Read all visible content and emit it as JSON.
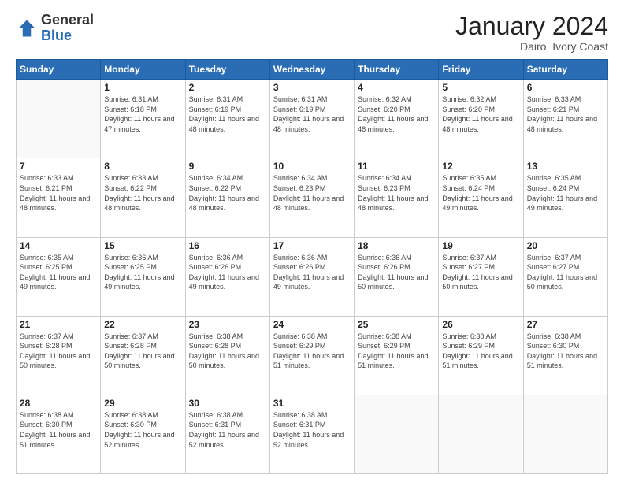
{
  "header": {
    "logo": {
      "general": "General",
      "blue": "Blue"
    },
    "title": "January 2024",
    "location": "Dairo, Ivory Coast"
  },
  "weekdays": [
    "Sunday",
    "Monday",
    "Tuesday",
    "Wednesday",
    "Thursday",
    "Friday",
    "Saturday"
  ],
  "weeks": [
    [
      {
        "day": "",
        "empty": true
      },
      {
        "day": "1",
        "sunrise": "6:31 AM",
        "sunset": "6:18 PM",
        "daylight": "11 hours and 47 minutes."
      },
      {
        "day": "2",
        "sunrise": "6:31 AM",
        "sunset": "6:19 PM",
        "daylight": "11 hours and 48 minutes."
      },
      {
        "day": "3",
        "sunrise": "6:31 AM",
        "sunset": "6:19 PM",
        "daylight": "11 hours and 48 minutes."
      },
      {
        "day": "4",
        "sunrise": "6:32 AM",
        "sunset": "6:20 PM",
        "daylight": "11 hours and 48 minutes."
      },
      {
        "day": "5",
        "sunrise": "6:32 AM",
        "sunset": "6:20 PM",
        "daylight": "11 hours and 48 minutes."
      },
      {
        "day": "6",
        "sunrise": "6:33 AM",
        "sunset": "6:21 PM",
        "daylight": "11 hours and 48 minutes."
      }
    ],
    [
      {
        "day": "7",
        "sunrise": "6:33 AM",
        "sunset": "6:21 PM",
        "daylight": "11 hours and 48 minutes."
      },
      {
        "day": "8",
        "sunrise": "6:33 AM",
        "sunset": "6:22 PM",
        "daylight": "11 hours and 48 minutes."
      },
      {
        "day": "9",
        "sunrise": "6:34 AM",
        "sunset": "6:22 PM",
        "daylight": "11 hours and 48 minutes."
      },
      {
        "day": "10",
        "sunrise": "6:34 AM",
        "sunset": "6:23 PM",
        "daylight": "11 hours and 48 minutes."
      },
      {
        "day": "11",
        "sunrise": "6:34 AM",
        "sunset": "6:23 PM",
        "daylight": "11 hours and 48 minutes."
      },
      {
        "day": "12",
        "sunrise": "6:35 AM",
        "sunset": "6:24 PM",
        "daylight": "11 hours and 49 minutes."
      },
      {
        "day": "13",
        "sunrise": "6:35 AM",
        "sunset": "6:24 PM",
        "daylight": "11 hours and 49 minutes."
      }
    ],
    [
      {
        "day": "14",
        "sunrise": "6:35 AM",
        "sunset": "6:25 PM",
        "daylight": "11 hours and 49 minutes."
      },
      {
        "day": "15",
        "sunrise": "6:36 AM",
        "sunset": "6:25 PM",
        "daylight": "11 hours and 49 minutes."
      },
      {
        "day": "16",
        "sunrise": "6:36 AM",
        "sunset": "6:26 PM",
        "daylight": "11 hours and 49 minutes."
      },
      {
        "day": "17",
        "sunrise": "6:36 AM",
        "sunset": "6:26 PM",
        "daylight": "11 hours and 49 minutes."
      },
      {
        "day": "18",
        "sunrise": "6:36 AM",
        "sunset": "6:26 PM",
        "daylight": "11 hours and 50 minutes."
      },
      {
        "day": "19",
        "sunrise": "6:37 AM",
        "sunset": "6:27 PM",
        "daylight": "11 hours and 50 minutes."
      },
      {
        "day": "20",
        "sunrise": "6:37 AM",
        "sunset": "6:27 PM",
        "daylight": "11 hours and 50 minutes."
      }
    ],
    [
      {
        "day": "21",
        "sunrise": "6:37 AM",
        "sunset": "6:28 PM",
        "daylight": "11 hours and 50 minutes."
      },
      {
        "day": "22",
        "sunrise": "6:37 AM",
        "sunset": "6:28 PM",
        "daylight": "11 hours and 50 minutes."
      },
      {
        "day": "23",
        "sunrise": "6:38 AM",
        "sunset": "6:28 PM",
        "daylight": "11 hours and 50 minutes."
      },
      {
        "day": "24",
        "sunrise": "6:38 AM",
        "sunset": "6:29 PM",
        "daylight": "11 hours and 51 minutes."
      },
      {
        "day": "25",
        "sunrise": "6:38 AM",
        "sunset": "6:29 PM",
        "daylight": "11 hours and 51 minutes."
      },
      {
        "day": "26",
        "sunrise": "6:38 AM",
        "sunset": "6:29 PM",
        "daylight": "11 hours and 51 minutes."
      },
      {
        "day": "27",
        "sunrise": "6:38 AM",
        "sunset": "6:30 PM",
        "daylight": "11 hours and 51 minutes."
      }
    ],
    [
      {
        "day": "28",
        "sunrise": "6:38 AM",
        "sunset": "6:30 PM",
        "daylight": "11 hours and 51 minutes."
      },
      {
        "day": "29",
        "sunrise": "6:38 AM",
        "sunset": "6:30 PM",
        "daylight": "11 hours and 52 minutes."
      },
      {
        "day": "30",
        "sunrise": "6:38 AM",
        "sunset": "6:31 PM",
        "daylight": "11 hours and 52 minutes."
      },
      {
        "day": "31",
        "sunrise": "6:38 AM",
        "sunset": "6:31 PM",
        "daylight": "11 hours and 52 minutes."
      },
      {
        "day": "",
        "empty": true
      },
      {
        "day": "",
        "empty": true
      },
      {
        "day": "",
        "empty": true
      }
    ]
  ]
}
